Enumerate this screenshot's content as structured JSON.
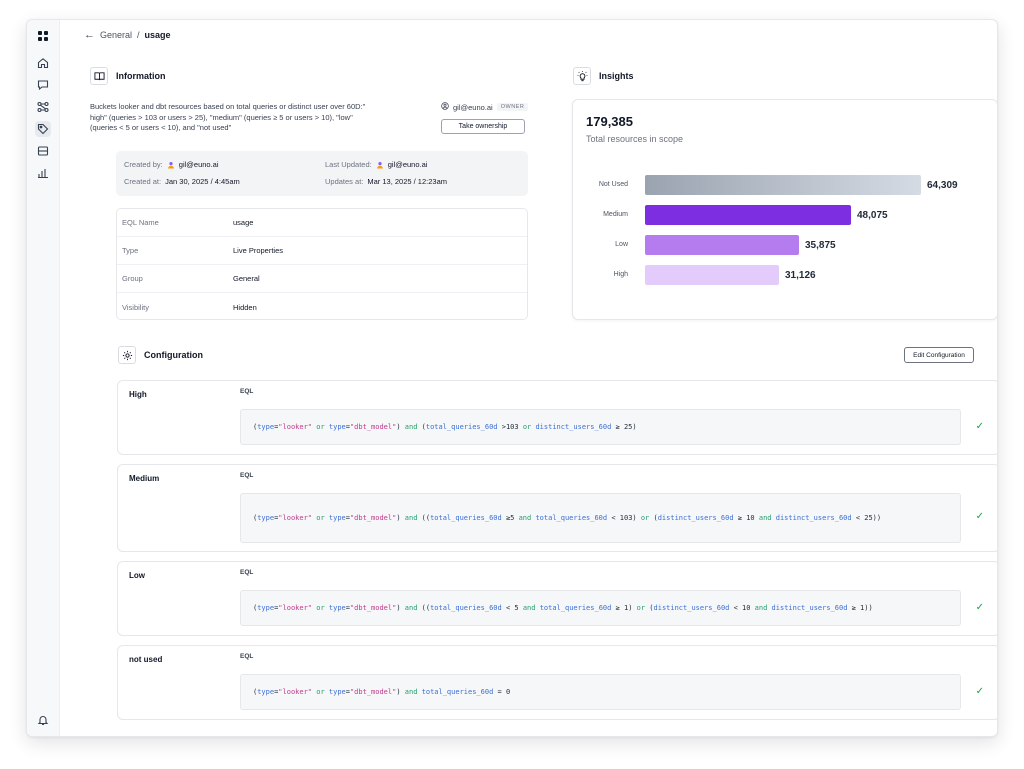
{
  "breadcrumb": {
    "parent": "General",
    "separator": "/",
    "current": "usage"
  },
  "sidebar": {
    "icons": [
      "apps-icon",
      "home-icon",
      "chat-icon",
      "flow-icon",
      "tag-icon",
      "storage-icon",
      "bar-chart-icon",
      "bell-icon"
    ]
  },
  "information": {
    "title": "Information",
    "description": "Buckets looker and dbt resources based on total queries or distinct user over 60D:\" high\" (queries > 103 or users > 25), \"medium\" (queries ≥ 5 or users > 10), \"low\" (queries < 5 or users < 10), and \"not used\"",
    "owner_email": "gil@euno.ai",
    "owner_badge": "OWNER",
    "take_ownership": "Take ownership",
    "created_by_label": "Created by:",
    "created_by": "gil@euno.ai",
    "created_at_label": "Created at:",
    "created_at": "Jan 30, 2025 / 4:45am",
    "last_updated_label": "Last Updated:",
    "last_updated_by": "gil@euno.ai",
    "updated_at_label": "Updates at:",
    "updated_at": "Mar 13, 2025 / 12:23am",
    "properties": [
      {
        "key": "EQL Name",
        "value": "usage"
      },
      {
        "key": "Type",
        "value": "Live Properties"
      },
      {
        "key": "Group",
        "value": "General"
      },
      {
        "key": "Visibility",
        "value": "Hidden"
      }
    ]
  },
  "insights": {
    "title": "Insights",
    "total": "179,385",
    "total_label": "Total resources in scope",
    "buckets": [
      {
        "label": "Not Used",
        "value": 64309,
        "display": "64,309",
        "color": "#a7b0bd"
      },
      {
        "label": "Medium",
        "value": 48075,
        "display": "48,075",
        "color": "#7c2ee0"
      },
      {
        "label": "Low",
        "value": 35875,
        "display": "35,875",
        "color": "#b57cf0"
      },
      {
        "label": "High",
        "value": 31126,
        "display": "31,126",
        "color": "#e3ccfb"
      }
    ]
  },
  "configuration": {
    "title": "Configuration",
    "edit_button": "Edit Configuration",
    "eql_label": "EQL",
    "rules": [
      {
        "name": "High",
        "eql": "(type=\"looker\" or type=\"dbt_model\") and (total_queries_60d >103 or distinct_users_60d ≥ 25)"
      },
      {
        "name": "Medium",
        "eql": "(type=\"looker\" or type=\"dbt_model\") and ((total_queries_60d ≥5 and total_queries_60d < 103) or (distinct_users_60d ≥ 10 and distinct_users_60d < 25))"
      },
      {
        "name": "Low",
        "eql": "(type=\"looker\" or type=\"dbt_model\") and ((total_queries_60d < 5 and total_queries_60d ≥ 1) or (distinct_users_60d < 10 and distinct_users_60d ≥ 1))"
      },
      {
        "name": "not used",
        "eql": "(type=\"looker\" or type=\"dbt_model\") and total_queries_60d = 0"
      }
    ]
  }
}
